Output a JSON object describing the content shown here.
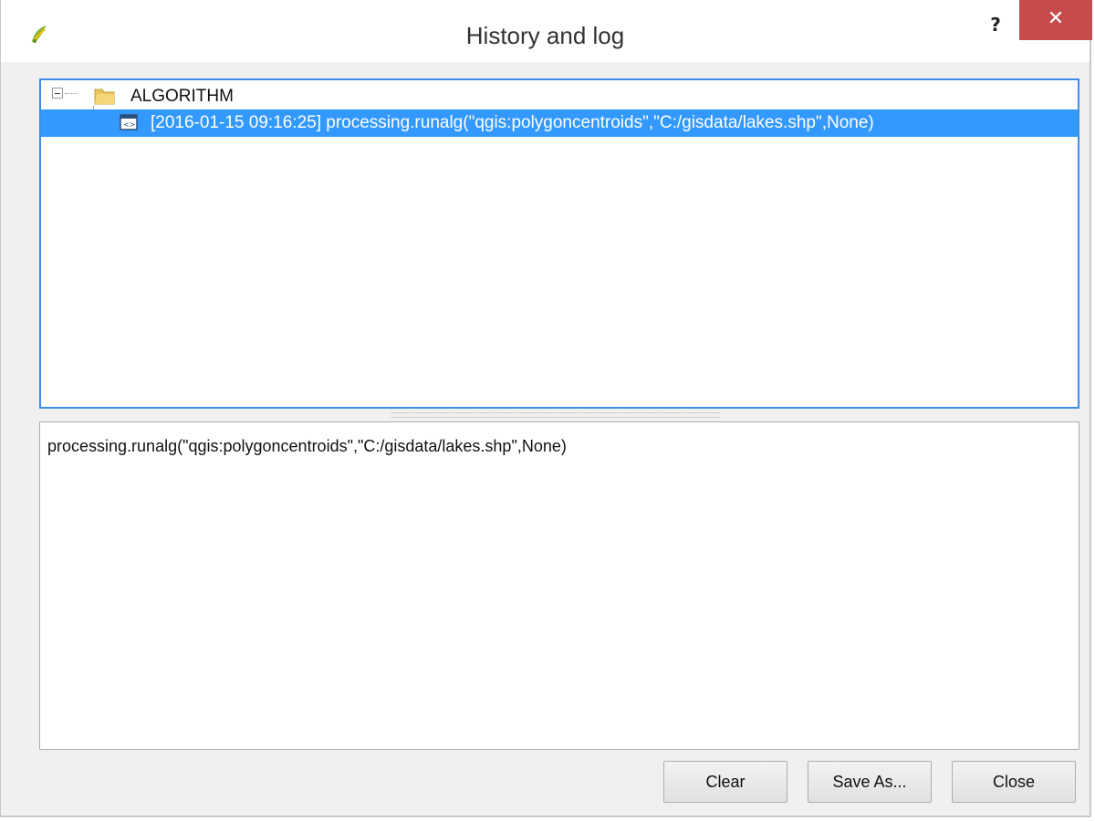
{
  "window": {
    "title": "History and log",
    "help_label": "?",
    "close_glyph": "✕"
  },
  "tree": {
    "root_label": "ALGORITHM",
    "entries": [
      {
        "label": "[2016-01-15 09:16:25] processing.runalg(\"qgis:polygoncentroids\",\"C:/gisdata/lakes.shp\",None)"
      }
    ]
  },
  "details": {
    "text": "processing.runalg(\"qgis:polygoncentroids\",\"C:/gisdata/lakes.shp\",None)"
  },
  "buttons": {
    "clear": "Clear",
    "save_as": "Save As...",
    "close": "Close"
  },
  "colors": {
    "selection": "#3399ff",
    "focus_border": "#3c8ee6",
    "close_button": "#c74b4b"
  },
  "icons": [
    "qgis-logo-icon",
    "help-icon",
    "close-icon",
    "collapse-icon",
    "folder-icon",
    "script-icon"
  ]
}
